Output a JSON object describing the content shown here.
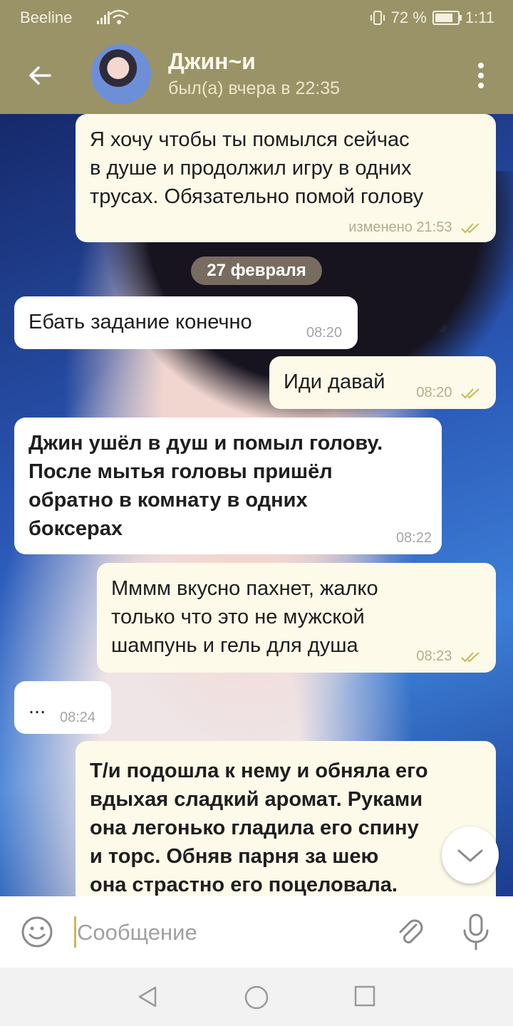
{
  "status_bar": {
    "carrier": "Beeline",
    "battery": "72 %",
    "time": "1:11"
  },
  "header": {
    "title": "Джин~и",
    "subtitle": "был(а) вчера в 22:35"
  },
  "date_separator": "27 февраля",
  "messages": [
    {
      "dir": "out",
      "text": "Я хочу чтобы ты помылся сейчас\nв душе и продолжил игру в одних\nтрусах. Обязательно помой голову",
      "time": "изменено 21:53",
      "status": "read"
    },
    {
      "dir": "in",
      "text": "Ебать задание конечно",
      "time": "08:20"
    },
    {
      "dir": "out",
      "text": "Иди давай",
      "time": "08:20",
      "status": "read"
    },
    {
      "dir": "in",
      "text": "Джин ушёл в душ и помыл голову.\nПосле мытья головы пришёл\nобратно в комнату в одних\nбоксерах",
      "time": "08:22",
      "bold": true
    },
    {
      "dir": "out",
      "text": "Мммм вкусно пахнет, жалко\nтолько что это не мужской\nшампунь и гель для душа",
      "time": "08:23",
      "status": "read"
    },
    {
      "dir": "in",
      "text": "...",
      "time": "08:24"
    },
    {
      "dir": "out",
      "text": "Т/и подошла к нему и обняла его\nвдыхая сладкий аромат. Руками\nона легонько гладила его спину\nи торс. Обняв парня за шею\nона страстно его поцеловала.",
      "bold": true
    }
  ],
  "input": {
    "placeholder": "Сообщение"
  },
  "icons": {
    "back": "arrow-left-icon",
    "menu": "more-vert-icon",
    "emoji": "smiley-icon",
    "attach": "paperclip-icon",
    "mic": "microphone-icon",
    "scroll": "chevron-down-icon",
    "read": "double-check-icon"
  },
  "colors": {
    "header": "#9a9368",
    "outgoing_bubble": "#fdfae9",
    "incoming_bubble": "#ffffff",
    "checkmark": "#c8b85a"
  }
}
